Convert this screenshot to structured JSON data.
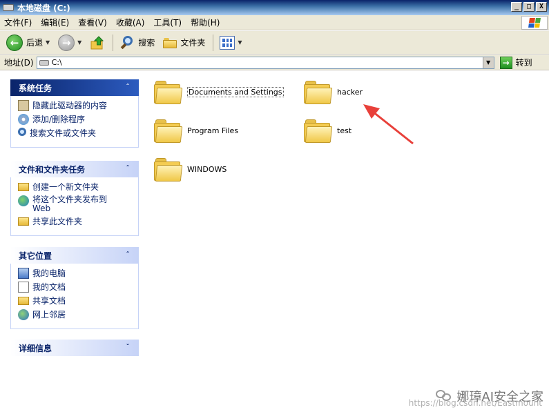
{
  "window": {
    "title": "本地磁盘 (C:)",
    "buttons": [
      "_",
      "□",
      "X"
    ]
  },
  "menu": {
    "items": [
      "文件(F)",
      "编辑(E)",
      "查看(V)",
      "收藏(A)",
      "工具(T)",
      "帮助(H)"
    ]
  },
  "toolbar": {
    "back_label": "后退",
    "search_label": "搜索",
    "folders_label": "文件夹"
  },
  "address": {
    "label": "地址(D)",
    "value": "C:\\",
    "go_label": "转到"
  },
  "taskpane": {
    "system_tasks": {
      "title": "系统任务",
      "items": [
        "隐藏此驱动器的内容",
        "添加/删除程序",
        "搜索文件或文件夹"
      ]
    },
    "file_tasks": {
      "title": "文件和文件夹任务",
      "items": [
        "创建一个新文件夹",
        "将这个文件夹发布到 Web",
        "共享此文件夹"
      ]
    },
    "other_places": {
      "title": "其它位置",
      "items": [
        "我的电脑",
        "我的文档",
        "共享文档",
        "网上邻居"
      ]
    },
    "details": {
      "title": "详细信息"
    }
  },
  "files": [
    {
      "name": "Documents and Settings"
    },
    {
      "name": "hacker"
    },
    {
      "name": "Program Files"
    },
    {
      "name": "test"
    },
    {
      "name": "WINDOWS"
    }
  ],
  "watermark": {
    "title": "娜璋AI安全之家",
    "url": "https://blog.csdn.net/Eastmount"
  },
  "colors": {
    "title_bar": "#0a246a",
    "accent": "#3a6ec8",
    "arrow": "#e8403a"
  }
}
